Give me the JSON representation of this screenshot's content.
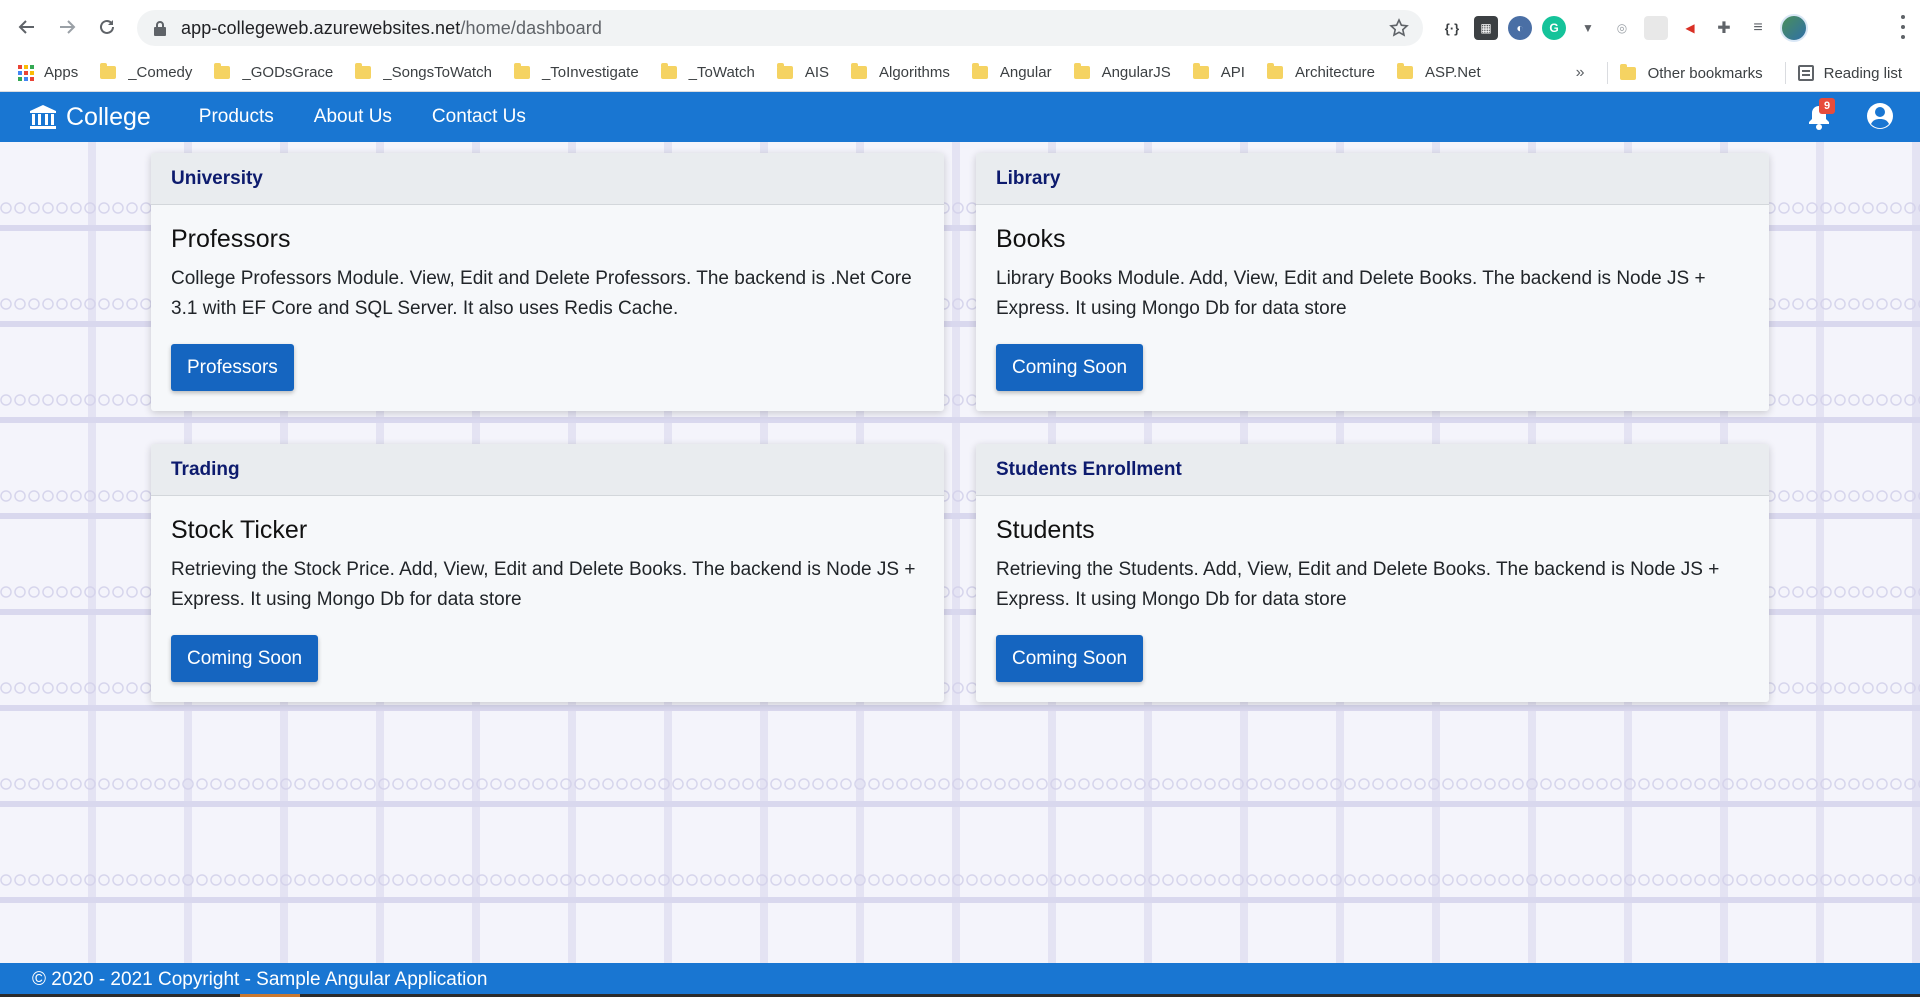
{
  "browser": {
    "url_host": "app-collegeweb.azurewebsites.net",
    "url_path": "/home/dashboard",
    "bookmarks": [
      {
        "label": "_Comedy"
      },
      {
        "label": "_GODsGrace"
      },
      {
        "label": "_SongsToWatch"
      },
      {
        "label": "_ToInvestigate"
      },
      {
        "label": "_ToWatch"
      },
      {
        "label": "AIS"
      },
      {
        "label": "Algorithms"
      },
      {
        "label": "Angular"
      },
      {
        "label": "AngularJS"
      },
      {
        "label": "API"
      },
      {
        "label": "Architecture"
      },
      {
        "label": "ASP.Net"
      }
    ],
    "apps_label": "Apps",
    "more_label": "»",
    "other_bookmarks": "Other bookmarks",
    "reading_list": "Reading list"
  },
  "navbar": {
    "brand": "College",
    "links": [
      {
        "label": "Products"
      },
      {
        "label": "About Us"
      },
      {
        "label": "Contact Us"
      }
    ],
    "notification_count": "9"
  },
  "cards": [
    {
      "header": "University",
      "title": "Professors",
      "text": "College Professors Module. View, Edit and Delete Professors. The backend is .Net Core 3.1 with EF Core and SQL Server. It also uses Redis Cache.",
      "button": "Professors"
    },
    {
      "header": "Library",
      "title": "Books",
      "text": "Library Books Module. Add, View, Edit and Delete Books. The backend is Node JS + Express. It using Mongo Db for data store",
      "button": "Coming Soon"
    },
    {
      "header": "Trading",
      "title": "Stock Ticker",
      "text": "Retrieving the Stock Price. Add, View, Edit and Delete Books. The backend is Node JS + Express. It using Mongo Db for data store",
      "button": "Coming Soon"
    },
    {
      "header": "Students Enrollment",
      "title": "Students",
      "text": "Retrieving the Students. Add, View, Edit and Delete Books. The backend is Node JS + Express. It using Mongo Db for data store",
      "button": "Coming Soon"
    }
  ],
  "footer": {
    "text": "© 2020 - 2021 Copyright - Sample Angular Application"
  },
  "colors": {
    "primary": "#1976d2",
    "button": "#1565c0",
    "card_header_text": "#0d1b6e"
  }
}
